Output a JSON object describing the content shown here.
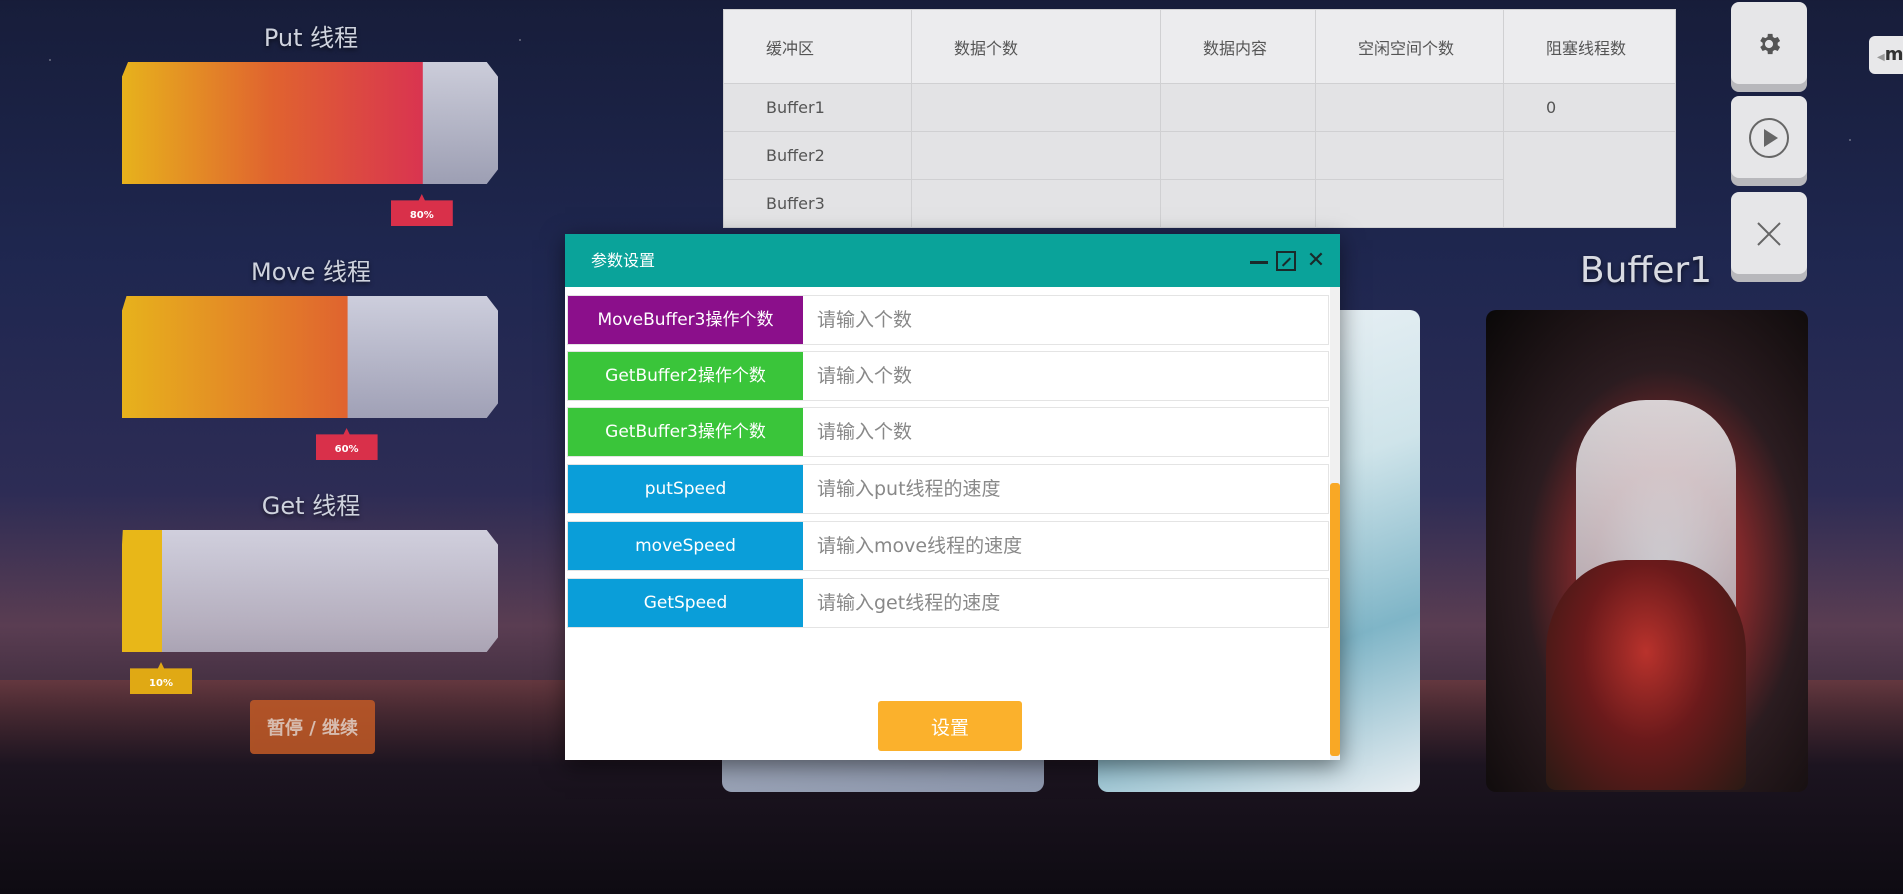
{
  "threads": [
    {
      "title": "Put 线程",
      "percent_label": "80%",
      "fill": 0.8,
      "fill_colors": [
        "#e7b21c",
        "#e0632f",
        "#d93450"
      ],
      "tag_color": "#d9304a"
    },
    {
      "title": "Move 线程",
      "percent_label": "60%",
      "fill": 0.6,
      "fill_colors": [
        "#e7b21c",
        "#e0632f"
      ],
      "tag_color": "#d9304a"
    },
    {
      "title": "Get 线程",
      "percent_label": "10%",
      "fill": 0.1,
      "fill_colors": [
        "#e8b718",
        "#e8b718"
      ],
      "tag_color": "#e0a914"
    }
  ],
  "pause_button_label": "暂停 / 继续",
  "table": {
    "headers": [
      "缓冲区",
      "数据个数",
      "数据内容",
      "空闲空间个数",
      "阻塞线程数"
    ],
    "rows": [
      [
        "Buffer1",
        "",
        "",
        "",
        "0"
      ],
      [
        "Buffer2",
        "",
        "",
        "",
        ""
      ],
      [
        "Buffer3",
        "",
        "",
        "",
        ""
      ]
    ]
  },
  "buffer_heading": "Buffer1",
  "modal": {
    "title": "参数设置",
    "rows": [
      {
        "label": "MoveBuffer3操作个数",
        "placeholder": "请输入个数",
        "color": "#8b0f8b"
      },
      {
        "label": "GetBuffer2操作个数",
        "placeholder": "请输入个数",
        "color": "#3ac53a"
      },
      {
        "label": "GetBuffer3操作个数",
        "placeholder": "请输入个数",
        "color": "#3ac53a"
      },
      {
        "label": "putSpeed",
        "placeholder": "请输入put线程的速度",
        "color": "#0a9ed9"
      },
      {
        "label": "moveSpeed",
        "placeholder": "请输入move线程的速度",
        "color": "#0a9ed9"
      },
      {
        "label": "GetSpeed",
        "placeholder": "请输入get线程的速度",
        "color": "#0a9ed9"
      }
    ],
    "submit_label": "设置"
  },
  "edge_tab_label": "m",
  "icons": {
    "settings": "gear-icon",
    "play": "play-icon",
    "close": "close-icon"
  }
}
